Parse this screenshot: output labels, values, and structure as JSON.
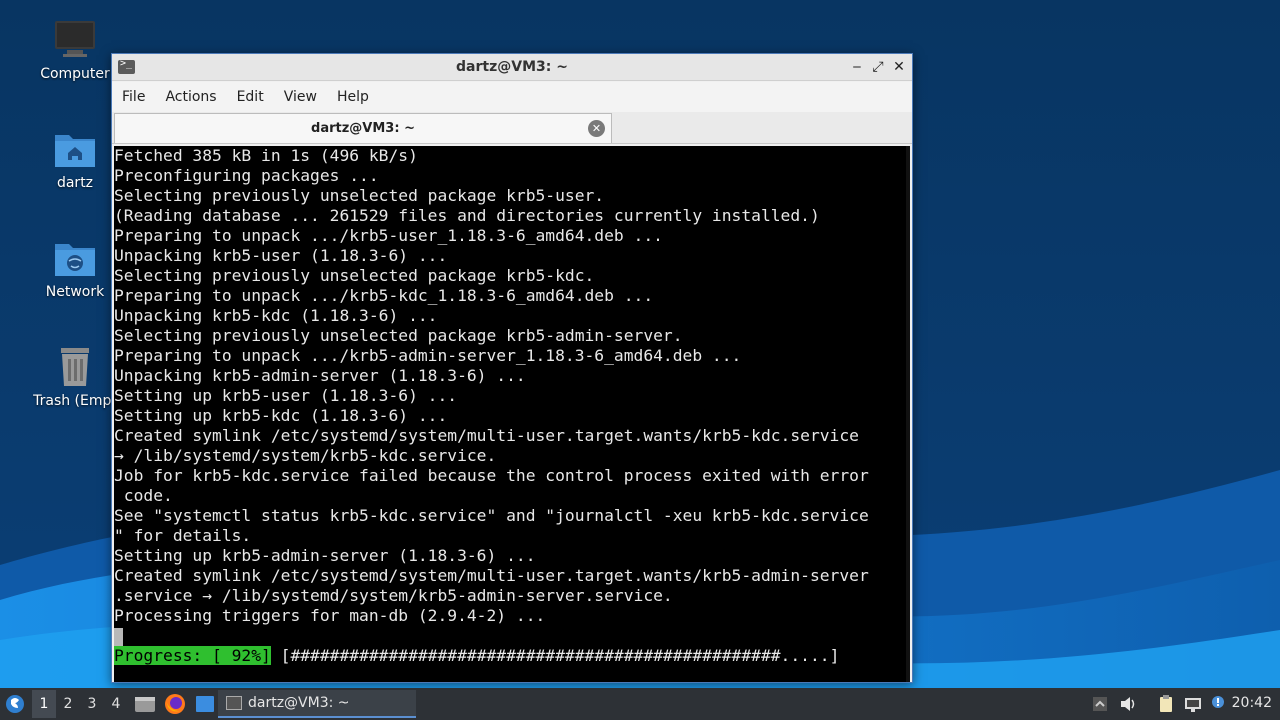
{
  "colors": {
    "desktop_bg": "#0a3a6b",
    "terminal_bg": "#000000",
    "terminal_fg": "#e8e8e8",
    "progress_bg": "#2fbf2f",
    "taskbar_bg": "#2d3136",
    "window_border": "#4a79b8"
  },
  "desktop": {
    "icons": [
      {
        "label": "Computer",
        "icon": "computer-icon"
      },
      {
        "label": "dartz",
        "icon": "home-folder-icon"
      },
      {
        "label": "Network",
        "icon": "network-folder-icon"
      },
      {
        "label": "Trash (Empt",
        "icon": "trash-icon"
      }
    ]
  },
  "window": {
    "title": "dartz@VM3: ~",
    "menu": [
      "File",
      "Actions",
      "Edit",
      "View",
      "Help"
    ],
    "tab_title": "dartz@VM3: ~",
    "controls": {
      "minimize": "‒",
      "maximize": "⤢",
      "close": "✕"
    }
  },
  "terminal": {
    "lines": [
      "Fetched 385 kB in 1s (496 kB/s)",
      "Preconfiguring packages ...",
      "Selecting previously unselected package krb5-user.",
      "(Reading database ... 261529 files and directories currently installed.)",
      "Preparing to unpack .../krb5-user_1.18.3-6_amd64.deb ...",
      "Unpacking krb5-user (1.18.3-6) ...",
      "Selecting previously unselected package krb5-kdc.",
      "Preparing to unpack .../krb5-kdc_1.18.3-6_amd64.deb ...",
      "Unpacking krb5-kdc (1.18.3-6) ...",
      "Selecting previously unselected package krb5-admin-server.",
      "Preparing to unpack .../krb5-admin-server_1.18.3-6_amd64.deb ...",
      "Unpacking krb5-admin-server (1.18.3-6) ...",
      "Setting up krb5-user (1.18.3-6) ...",
      "Setting up krb5-kdc (1.18.3-6) ...",
      "Created symlink /etc/systemd/system/multi-user.target.wants/krb5-kdc.service",
      "→ /lib/systemd/system/krb5-kdc.service.",
      "Job for krb5-kdc.service failed because the control process exited with error",
      " code.",
      "See \"systemctl status krb5-kdc.service\" and \"journalctl -xeu krb5-kdc.service",
      "\" for details.",
      "Setting up krb5-admin-server (1.18.3-6) ...",
      "Created symlink /etc/systemd/system/multi-user.target.wants/krb5-admin-server",
      ".service → /lib/systemd/system/krb5-admin-server.service.",
      "Processing triggers for man-db (2.9.4-2) ..."
    ],
    "progress_label": "Progress: [ 92%]",
    "progress_bar": " [##################################################.....]",
    "progress_percent": 92
  },
  "taskbar": {
    "workspaces": [
      "1",
      "2",
      "3",
      "4"
    ],
    "active_workspace": "1",
    "task_label": "dartz@VM3: ~",
    "clock": "20:42"
  }
}
